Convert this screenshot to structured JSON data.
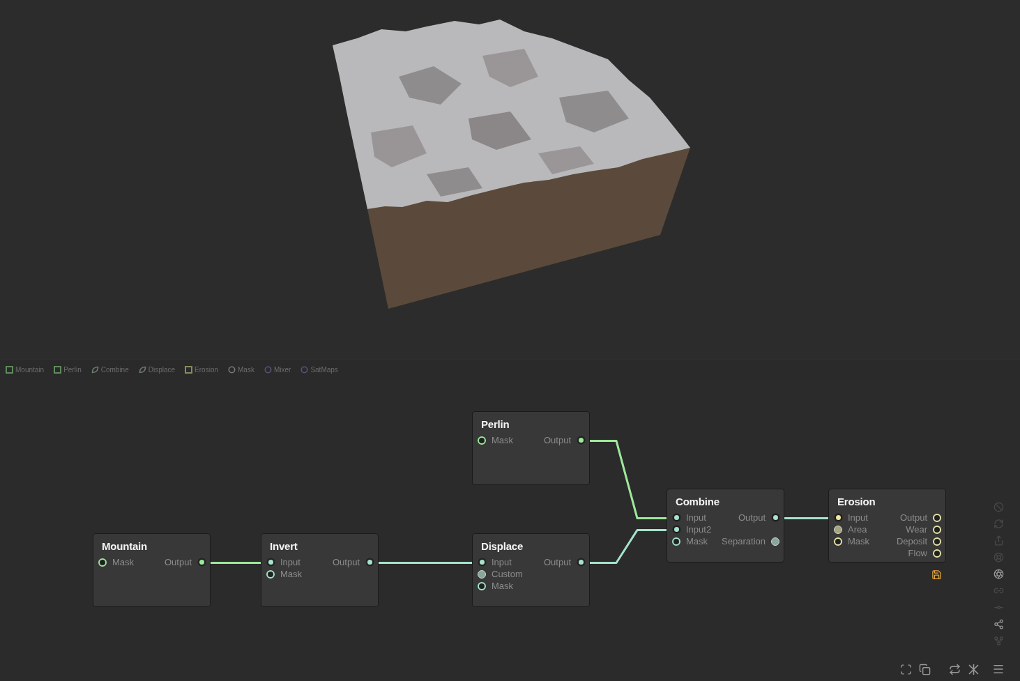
{
  "legend": [
    {
      "label": "Mountain",
      "kind": "square",
      "color": "#5f8a5c"
    },
    {
      "label": "Perlin",
      "kind": "square",
      "color": "#5f8a5c"
    },
    {
      "label": "Combine",
      "kind": "leaf",
      "color": "#6e7a6e"
    },
    {
      "label": "Displace",
      "kind": "leaf",
      "color": "#6e7a6e"
    },
    {
      "label": "Erosion",
      "kind": "square",
      "color": "#8a8a5a"
    },
    {
      "label": "Mask",
      "kind": "circle",
      "color": "#7a7a7a"
    },
    {
      "label": "Mixer",
      "kind": "circle",
      "color": "#55557a"
    },
    {
      "label": "SatMaps",
      "kind": "circle",
      "color": "#55557a"
    }
  ],
  "nodes": [
    {
      "title": "Perlin",
      "rows": [
        {
          "input": {
            "label": "Mask",
            "kind": "open",
            "color": "#9ee89a"
          },
          "output": {
            "label": "Output",
            "kind": "connected",
            "color": "#9ee89a"
          }
        }
      ]
    },
    {
      "title": "Combine",
      "rows": [
        {
          "input": {
            "label": "Input",
            "kind": "connected",
            "color": "#a6e3cc"
          },
          "output": {
            "label": "Output",
            "kind": "connected",
            "color": "#a6e3cc"
          }
        },
        {
          "input": {
            "label": "Input2",
            "kind": "connected",
            "color": "#a6e3cc"
          }
        },
        {
          "input": {
            "label": "Mask",
            "kind": "open",
            "color": "#a6e3cc"
          },
          "output": {
            "label": "Separation",
            "kind": "filled",
            "color": "#8aa69a"
          }
        }
      ]
    },
    {
      "title": "Erosion",
      "saved": true,
      "rows": [
        {
          "input": {
            "label": "Input",
            "kind": "connected",
            "color": "#f0e8a0"
          },
          "output": {
            "label": "Output",
            "kind": "open",
            "color": "#e8e0a8"
          }
        },
        {
          "input": {
            "label": "Area",
            "kind": "filled",
            "color": "#a8a480"
          },
          "output": {
            "label": "Wear",
            "kind": "open",
            "color": "#e8e0a8"
          }
        },
        {
          "input": {
            "label": "Mask",
            "kind": "open",
            "color": "#e8e0a8"
          },
          "output": {
            "label": "Deposit",
            "kind": "open",
            "color": "#e8e0a8"
          }
        },
        {
          "output": {
            "label": "Flow",
            "kind": "open",
            "color": "#e8e0a8"
          }
        }
      ]
    },
    {
      "title": "Mountain",
      "rows": [
        {
          "input": {
            "label": "Mask",
            "kind": "open",
            "color": "#9ee89a"
          },
          "output": {
            "label": "Output",
            "kind": "connected",
            "color": "#9ee89a"
          }
        }
      ]
    },
    {
      "title": "Invert",
      "rows": [
        {
          "input": {
            "label": "Input",
            "kind": "connected",
            "color": "#a6e3cc"
          },
          "output": {
            "label": "Output",
            "kind": "connected",
            "color": "#a6e3cc"
          }
        },
        {
          "input": {
            "label": "Mask",
            "kind": "open",
            "color": "#a6e3cc"
          }
        }
      ]
    },
    {
      "title": "Displace",
      "rows": [
        {
          "input": {
            "label": "Input",
            "kind": "connected",
            "color": "#a6e3cc"
          },
          "output": {
            "label": "Output",
            "kind": "connected",
            "color": "#a6e3cc"
          }
        },
        {
          "input": {
            "label": "Custom",
            "kind": "filled",
            "color": "#8aa69a"
          }
        },
        {
          "input": {
            "label": "Mask",
            "kind": "open",
            "color": "#a6e3cc"
          }
        }
      ]
    }
  ],
  "wires": [
    {
      "color": "#9ee89a"
    },
    {
      "color": "#a6e3cc"
    },
    {
      "color": "#9ee89a"
    },
    {
      "color": "#a6e3cc"
    },
    {
      "color": "#a6e3cc"
    }
  ]
}
